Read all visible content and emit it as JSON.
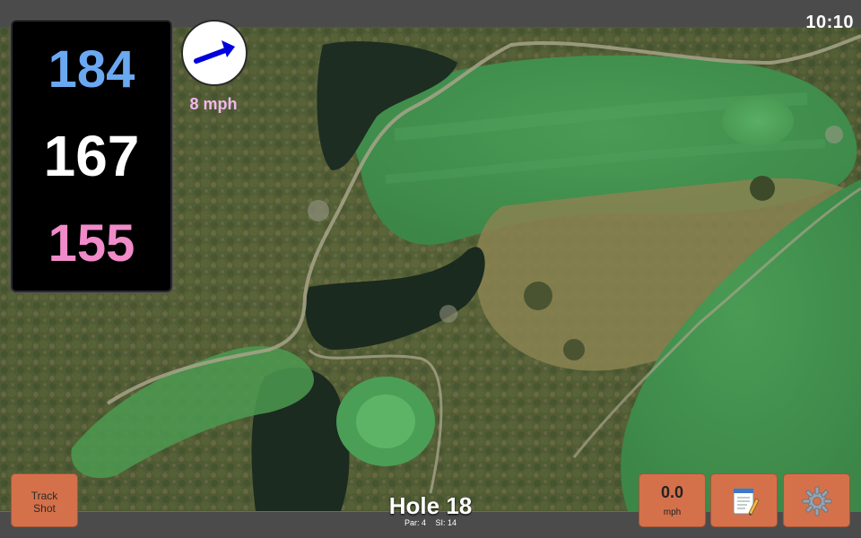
{
  "status": {
    "clock": "10:10"
  },
  "distances": {
    "back": "184",
    "middle": "167",
    "front": "155",
    "colors": {
      "back": "#6aa8f0",
      "middle": "#ffffff",
      "front": "#f08ac8"
    }
  },
  "wind": {
    "speed_label": "8 mph",
    "direction": "east-northeast",
    "label_color": "#f2b7f0",
    "arrow_color": "#0000dd"
  },
  "hole": {
    "title": "Hole 18",
    "par_label": "Par: 4",
    "si_label": "SI: 14"
  },
  "controls": {
    "track_shot_label_1": "Track",
    "track_shot_label_2": "Shot",
    "speed_value": "0.0",
    "speed_unit": "mph",
    "notes_icon": "notepad-icon",
    "settings_icon": "gear-icon",
    "button_color": "#d4714b"
  }
}
